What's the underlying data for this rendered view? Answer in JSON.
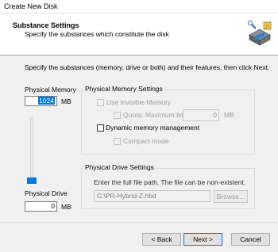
{
  "window": {
    "title": "Create New Disk"
  },
  "header": {
    "title": "Substance Settings",
    "subtitle": "Specify the substances which constitute the disk"
  },
  "instructions": "Specify the substances (memory, drive or both) and their features, then click Next.",
  "physical_memory": {
    "label": "Physical Memory",
    "value": "1024",
    "unit": "MB"
  },
  "physical_drive": {
    "label": "Physical Drive",
    "value": "0",
    "unit": "MB"
  },
  "slider": {
    "memory_fraction": 1.0
  },
  "memory_settings": {
    "title": "Physical Memory Settings",
    "use_invisible_memory": {
      "label": "Use Invisible Memory",
      "checked": false,
      "enabled": false
    },
    "quota": {
      "label": "Quota: Maximum limit",
      "value": "0",
      "unit": "MB",
      "checked": false,
      "enabled": false
    },
    "dynamic_memory": {
      "label": "Dynamic memory management",
      "checked": false,
      "enabled": true
    },
    "compact_mode": {
      "label": "Compact mode",
      "checked": false,
      "enabled": false
    }
  },
  "drive_settings": {
    "title": "Physical Drive Settings",
    "hint": "Enter the full file path. The file can be non-existent.",
    "path_value": "C:\\PR-Hybrid-Z.hbd",
    "browse_label": "Browse..."
  },
  "buttons": {
    "back": "< Back",
    "next": "Next >",
    "cancel": "Cancel"
  },
  "colors": {
    "accent": "#0078d7"
  }
}
